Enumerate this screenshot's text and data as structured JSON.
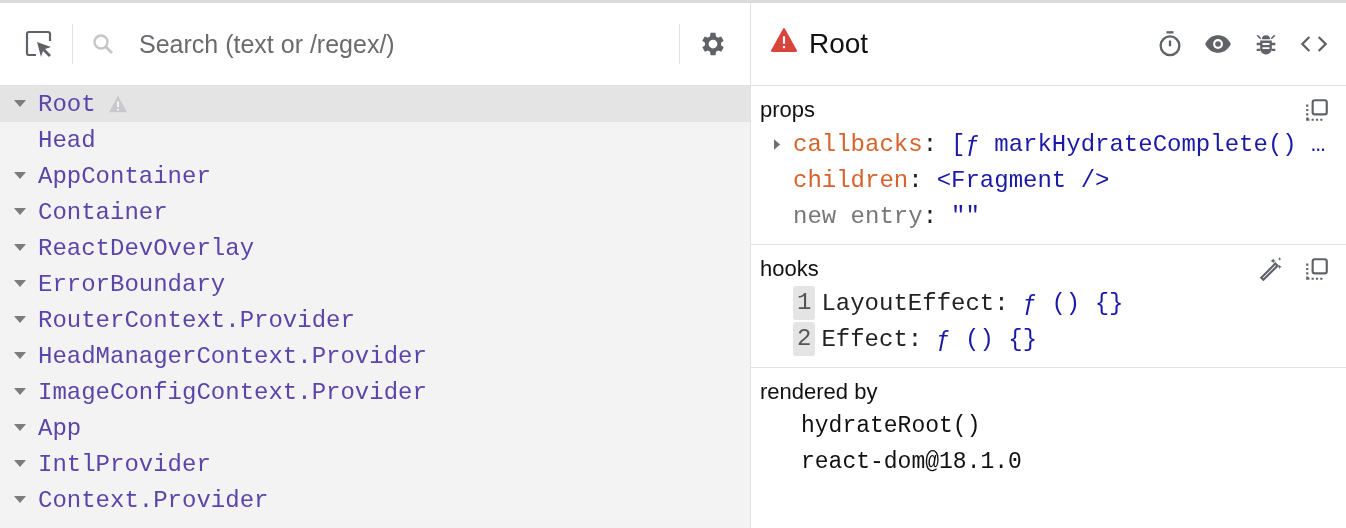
{
  "toolbar": {
    "search": {
      "placeholder": "Search (text or /regex/)"
    }
  },
  "tree": [
    {
      "label": "Root",
      "kind": "parent",
      "selected": true,
      "warning": true
    },
    {
      "label": "Head",
      "kind": "leaf",
      "selected": false,
      "warning": false
    },
    {
      "label": "AppContainer",
      "kind": "parent",
      "selected": false,
      "warning": false
    },
    {
      "label": "Container",
      "kind": "parent",
      "selected": false,
      "warning": false
    },
    {
      "label": "ReactDevOverlay",
      "kind": "parent",
      "selected": false,
      "warning": false
    },
    {
      "label": "ErrorBoundary",
      "kind": "parent",
      "selected": false,
      "warning": false
    },
    {
      "label": "RouterContext.Provider",
      "kind": "parent",
      "selected": false,
      "warning": false
    },
    {
      "label": "HeadManagerContext.Provider",
      "kind": "parent",
      "selected": false,
      "warning": false
    },
    {
      "label": "ImageConfigContext.Provider",
      "kind": "parent",
      "selected": false,
      "warning": false
    },
    {
      "label": "App",
      "kind": "parent",
      "selected": false,
      "warning": false
    },
    {
      "label": "IntlProvider",
      "kind": "parent",
      "selected": false,
      "warning": false
    },
    {
      "label": "Context.Provider",
      "kind": "parent",
      "selected": false,
      "warning": false
    }
  ],
  "inspector": {
    "title": "Root",
    "warning": true,
    "props": {
      "heading": "props",
      "entries": [
        {
          "key": "callbacks",
          "separator": ":",
          "kind": "expandable",
          "value": "[ƒ markHydrateComplete() …"
        },
        {
          "key": "children",
          "separator": ":",
          "kind": "prop",
          "value": "<Fragment />"
        },
        {
          "key": "new entry",
          "separator": ":",
          "kind": "new",
          "value": "\"\""
        }
      ]
    },
    "hooks": {
      "heading": "hooks",
      "entries": [
        {
          "index": "1",
          "name": "LayoutEffect",
          "separator": ":",
          "value": "ƒ () {}"
        },
        {
          "index": "2",
          "name": "Effect",
          "separator": ":",
          "value": "ƒ () {}"
        }
      ]
    },
    "rendered_by": {
      "heading": "rendered by",
      "items": [
        "hydrateRoot()",
        "react-dom@18.1.0"
      ]
    }
  }
}
